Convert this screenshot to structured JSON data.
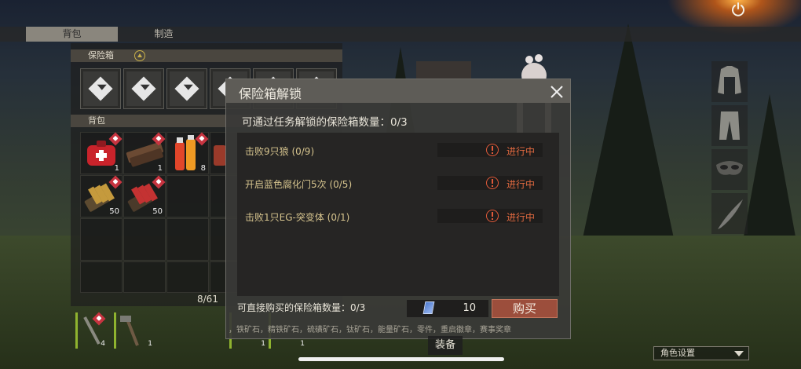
{
  "tabs": {
    "backpack": "背包",
    "craft": "制造"
  },
  "vault_section": {
    "label": "保险箱",
    "slot_count": 6
  },
  "backpack_section": {
    "label": "背包",
    "capacity": "8/61",
    "items": [
      {
        "icon": "medkit-icon",
        "qty": "1"
      },
      {
        "icon": "wood-plank-icon",
        "qty": "1"
      },
      {
        "icon": "bottles-icon",
        "qty": "8"
      },
      {
        "icon": "partial-item-icon",
        "qty": ""
      },
      {
        "icon": "ammo-bundle-icon",
        "qty": "50"
      },
      {
        "icon": "shotgun-shells-icon",
        "qty": "50"
      }
    ]
  },
  "hotbar": [
    {
      "icon": "wrench-icon",
      "qty": "4"
    },
    {
      "icon": "axe-icon",
      "qty": "1"
    },
    {
      "icon": "tool-icon",
      "qty": "1"
    },
    {
      "icon": "tool-icon",
      "qty": "1"
    }
  ],
  "dialog": {
    "title": "保险箱解锁",
    "task_unlock_count": "可通过任务解锁的保险箱数量：0/3",
    "tasks": [
      {
        "label": "击败9只狼 (0/9)",
        "status": "进行中"
      },
      {
        "label": "开启蓝色腐化门5次 (0/5)",
        "status": "进行中"
      },
      {
        "label": "击败1只EG-突变体 (0/1)",
        "status": "进行中"
      }
    ],
    "buy_count": "可直接购买的保险箱数量：0/3",
    "price": "10",
    "buy_label": "购买"
  },
  "footer_note": "，铁矿石，精铁矿石，硫磺矿石，钛矿石，能量矿石，零件，重启徽章，赛事奖章",
  "equip_label": "装备",
  "role_settings": "角色设置",
  "equipment_slots": [
    "jacket-icon",
    "pants-icon",
    "mask-icon",
    "feather-icon"
  ],
  "colors": {
    "accent_buy": "#9c4e3c",
    "status_orange": "#e26a40",
    "task_gold": "#d6c48e",
    "lock_red": "#c73440"
  }
}
